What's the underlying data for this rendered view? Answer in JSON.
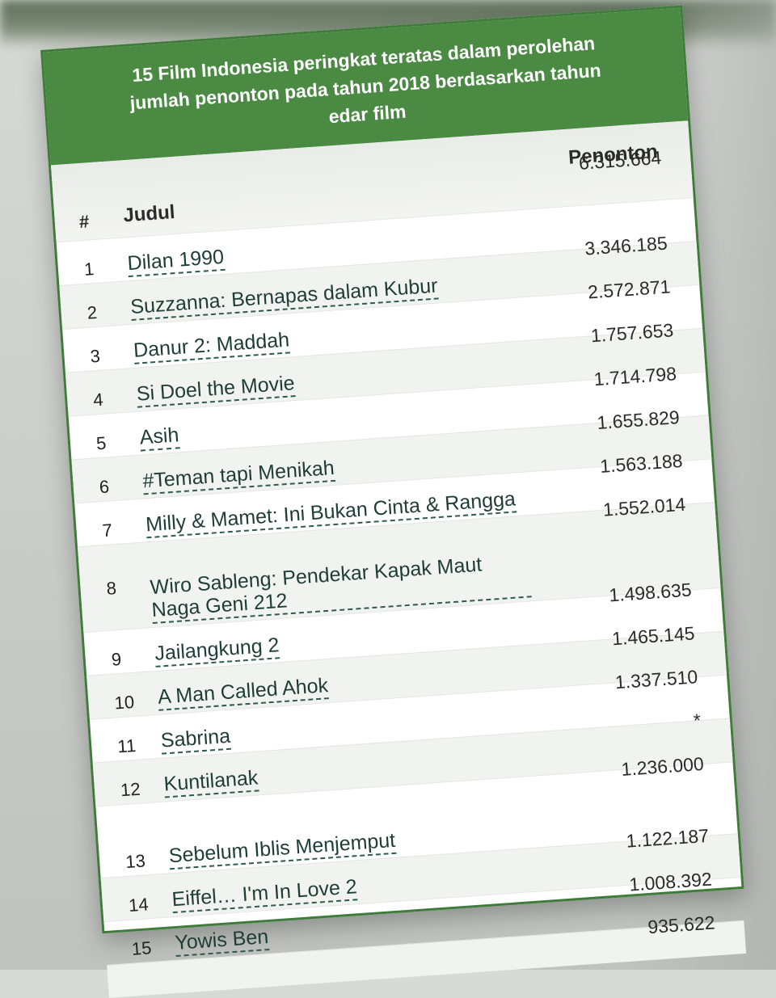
{
  "table": {
    "title_lines": [
      "15 Film Indonesia peringkat teratas dalam perolehan",
      "jumlah penonton pada tahun 2018 berdasarkan tahun",
      "edar film"
    ],
    "headers": {
      "number": "#",
      "title": "Judul",
      "viewers": "Penonton"
    },
    "rows": [
      {
        "rank": "1",
        "film": "Dilan 1990",
        "viewers": "6.315.664"
      },
      {
        "rank": "2",
        "film": "Suzzanna: Bernapas dalam Kubur",
        "viewers": "3.346.185"
      },
      {
        "rank": "3",
        "film": "Danur 2: Maddah",
        "viewers": "2.572.871"
      },
      {
        "rank": "4",
        "film": "Si Doel the Movie",
        "viewers": "1.757.653"
      },
      {
        "rank": "5",
        "film": "Asih",
        "viewers": "1.714.798"
      },
      {
        "rank": "6",
        "film": "#Teman tapi Menikah",
        "viewers": "1.655.829"
      },
      {
        "rank": "7",
        "film": "Milly & Mamet: Ini Bukan Cinta & Rangga",
        "viewers": "1.563.188"
      },
      {
        "rank": "8",
        "film": "Wiro Sableng: Pendekar Kapak Maut Naga Geni 212",
        "viewers": "1.552.014"
      },
      {
        "rank": "9",
        "film": "Jailangkung 2",
        "viewers": "1.498.635"
      },
      {
        "rank": "10",
        "film": "A Man Called Ahok",
        "viewers": "1.465.145"
      },
      {
        "rank": "11",
        "film": "Sabrina",
        "viewers": "1.337.510"
      },
      {
        "rank": "12",
        "film": "Kuntilanak",
        "viewers": "*"
      },
      {
        "rank": "13",
        "film": "Sebelum Iblis Menjemput",
        "viewers": "1.236.000"
      },
      {
        "rank": "14",
        "film": "Eiffel… I'm In Love 2",
        "viewers": "1.122.187"
      },
      {
        "rank": "15",
        "film": "Yowis Ben",
        "viewers": "1.008.392"
      }
    ],
    "trailing_viewers": "935.622"
  }
}
